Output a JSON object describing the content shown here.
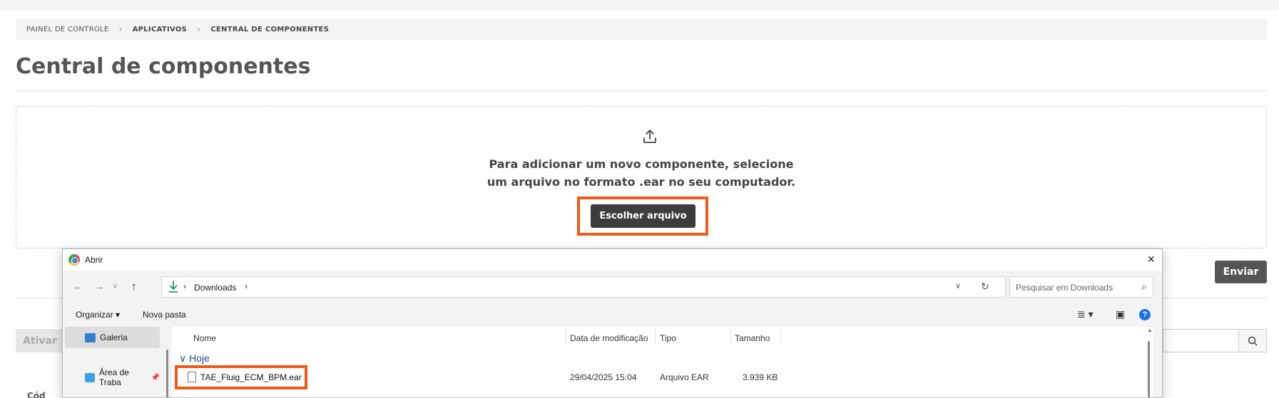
{
  "breadcrumb": {
    "items": [
      "PAINEL DE CONTROLE",
      "APLICATIVOS",
      "CENTRAL DE COMPONENTES"
    ],
    "separator": ">"
  },
  "page": {
    "title": "Central de componentes",
    "dropzone_line1": "Para adicionar um novo componente, selecione",
    "dropzone_line2": "um arquivo no formato .ear no seu computador.",
    "choose_button": "Escolher arquivo",
    "send_button": "Enviar",
    "activate_button": "Ativar",
    "cut_text": "Cód"
  },
  "dialog": {
    "title": "Abrir",
    "close_icon": "×",
    "address_location": "Downloads",
    "search_placeholder": "Pesquisar em Downloads",
    "toolbar": {
      "organize": "Organizar ▾",
      "new_folder": "Nova pasta"
    },
    "sidebar": [
      {
        "label": "Galeria",
        "icon": "gallery-icon",
        "selected": true
      },
      {
        "label": "Área de Traba",
        "icon": "desktop-icon",
        "selected": false
      }
    ],
    "columns": {
      "name": "Nome",
      "modified": "Data de modificação",
      "type": "Tipo",
      "size": "Tamanho"
    },
    "group": "∨  Hoje",
    "file": {
      "name": "TAE_Fluig_ECM_BPM.ear",
      "modified": "29/04/2025 15:04",
      "type": "Arquivo EAR",
      "size": "3.939 KB"
    }
  },
  "colors": {
    "highlight": "#f05a16",
    "dark_button": "#3d3d3d",
    "link_blue": "#1e4d8c"
  }
}
